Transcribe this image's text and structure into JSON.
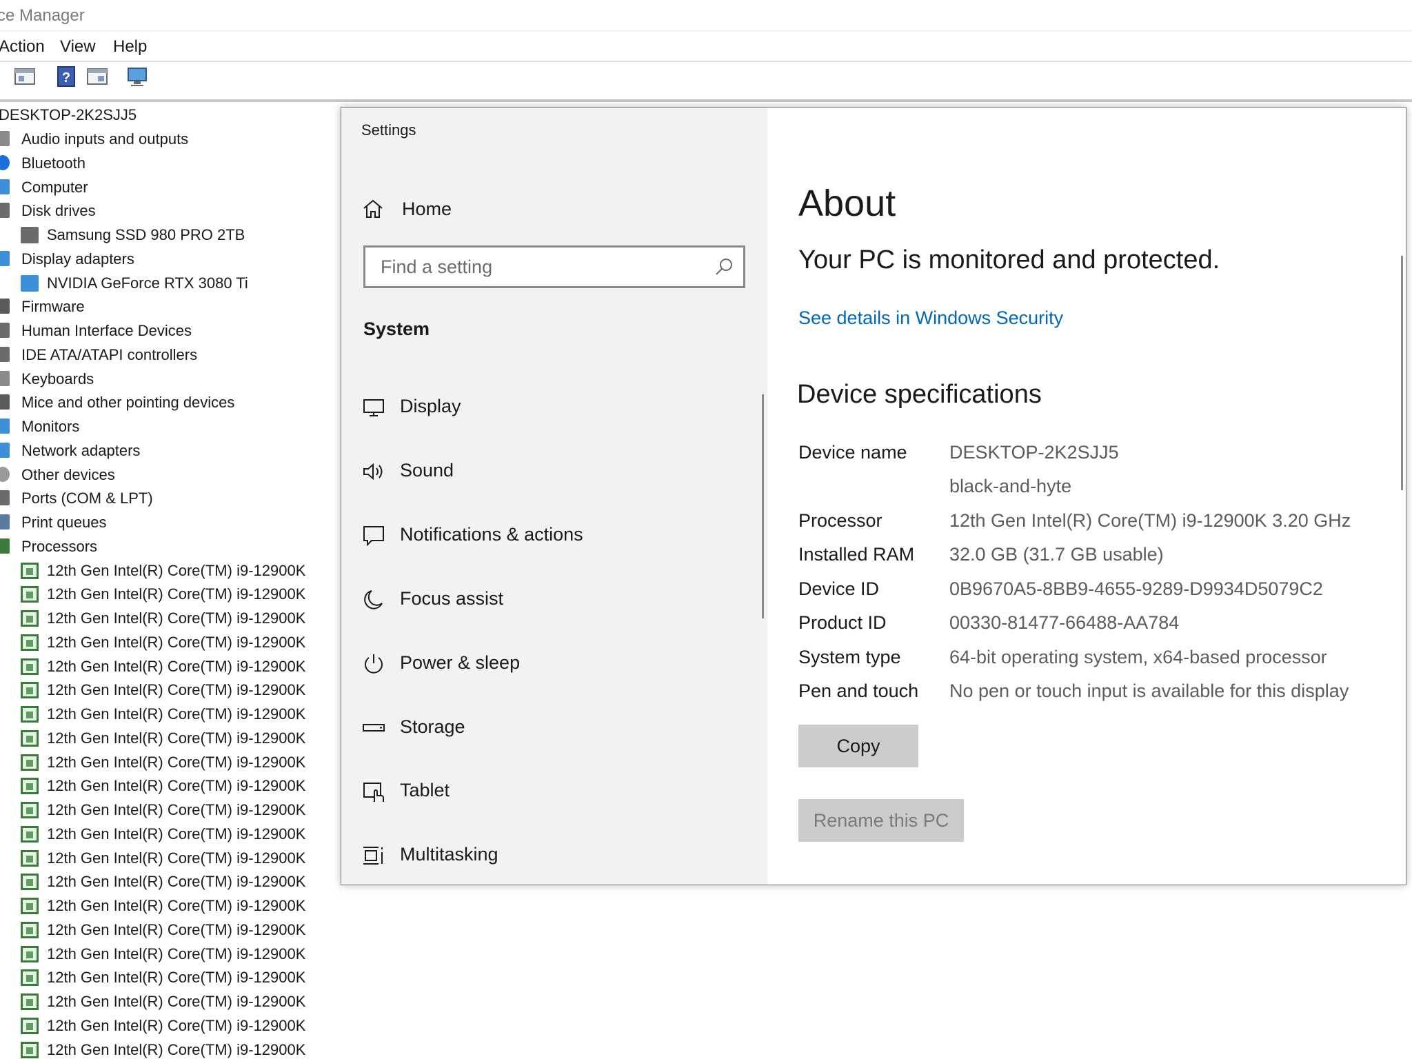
{
  "device_manager": {
    "title": "ce Manager",
    "menu": [
      "Action",
      "View",
      "Help"
    ],
    "toolbar_icons": [
      "properties-icon",
      "help-icon",
      "update-driver-icon",
      "scan-hardware-icon"
    ],
    "tree": {
      "root": "DESKTOP-2K2SJJ5",
      "categories": [
        {
          "label": "Audio inputs and outputs",
          "icon": "speaker-icon"
        },
        {
          "label": "Bluetooth",
          "icon": "bluetooth-icon"
        },
        {
          "label": "Computer",
          "icon": "computer-icon"
        },
        {
          "label": "Disk drives",
          "icon": "disk-drive-icon"
        },
        {
          "label": "Samsung SSD 980 PRO 2TB",
          "icon": "disk-drive-icon",
          "child": true
        },
        {
          "label": "Display adapters",
          "icon": "display-adapter-icon"
        },
        {
          "label": "NVIDIA GeForce RTX 3080 Ti",
          "icon": "display-adapter-icon",
          "child": true
        },
        {
          "label": "Firmware",
          "icon": "firmware-icon"
        },
        {
          "label": "Human Interface Devices",
          "icon": "hid-icon"
        },
        {
          "label": "IDE ATA/ATAPI controllers",
          "icon": "ide-controller-icon"
        },
        {
          "label": "Keyboards",
          "icon": "keyboard-icon"
        },
        {
          "label": "Mice and other pointing devices",
          "icon": "mouse-icon"
        },
        {
          "label": "Monitors",
          "icon": "monitor-icon"
        },
        {
          "label": "Network adapters",
          "icon": "network-adapter-icon"
        },
        {
          "label": "Other devices",
          "icon": "unknown-device-icon"
        },
        {
          "label": "Ports (COM & LPT)",
          "icon": "port-icon"
        },
        {
          "label": "Print queues",
          "icon": "printer-icon"
        },
        {
          "label": "Processors",
          "icon": "processor-icon"
        }
      ],
      "processor_label": "12th Gen Intel(R) Core(TM) i9-12900K",
      "processor_count_visible": 21
    }
  },
  "settings": {
    "window_title": "Settings",
    "nav": {
      "home_label": "Home",
      "search_placeholder": "Find a setting",
      "section_label": "System",
      "items": [
        {
          "label": "Display",
          "icon": "display-icon"
        },
        {
          "label": "Sound",
          "icon": "sound-icon"
        },
        {
          "label": "Notifications & actions",
          "icon": "notifications-icon"
        },
        {
          "label": "Focus assist",
          "icon": "moon-icon"
        },
        {
          "label": "Power & sleep",
          "icon": "power-icon"
        },
        {
          "label": "Storage",
          "icon": "storage-icon"
        },
        {
          "label": "Tablet",
          "icon": "tablet-icon"
        },
        {
          "label": "Multitasking",
          "icon": "multitasking-icon"
        }
      ]
    },
    "content": {
      "title": "About",
      "protected_text": "Your PC is monitored and protected.",
      "security_link": "See details in Windows Security",
      "specs_heading": "Device specifications",
      "specs": [
        {
          "label": "Device name",
          "value": "DESKTOP-2K2SJJ5"
        },
        {
          "label": "",
          "value": "black-and-hyte"
        },
        {
          "label": "Processor",
          "value": "12th Gen Intel(R) Core(TM) i9-12900K   3.20 GHz"
        },
        {
          "label": "Installed RAM",
          "value": "32.0 GB (31.7 GB usable)"
        },
        {
          "label": "Device ID",
          "value": "0B9670A5-8BB9-4655-9289-D9934D5079C2"
        },
        {
          "label": "Product ID",
          "value": "00330-81477-66488-AA784"
        },
        {
          "label": "System type",
          "value": "64-bit operating system, x64-based processor"
        },
        {
          "label": "Pen and touch",
          "value": "No pen or touch input is available for this display"
        }
      ],
      "copy_button": "Copy",
      "rename_button": "Rename this PC"
    },
    "link_color": "#0067c0"
  }
}
